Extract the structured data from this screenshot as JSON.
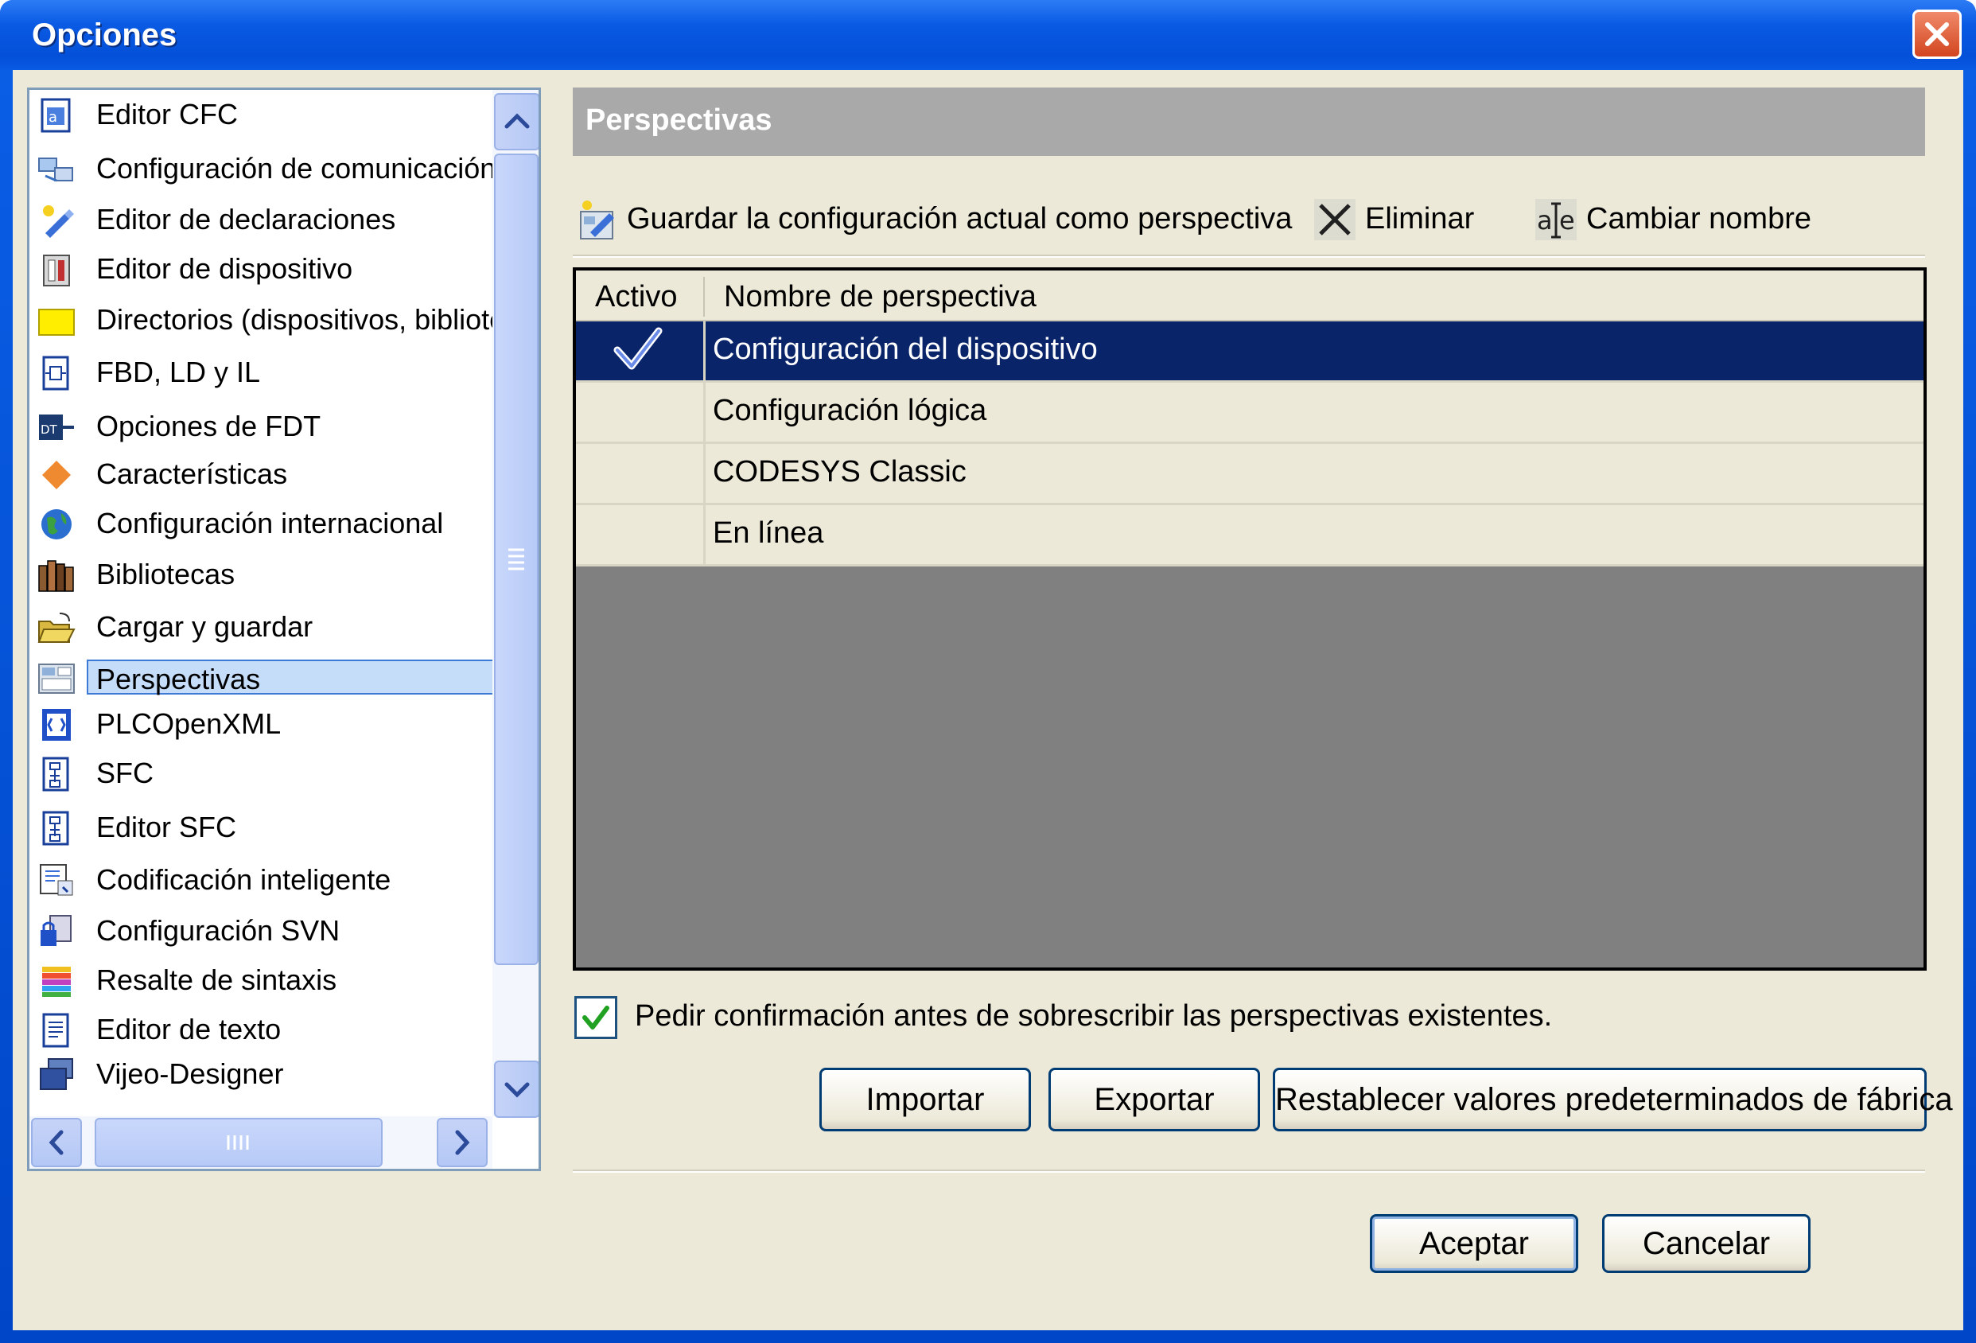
{
  "window": {
    "title": "Opciones"
  },
  "tree": {
    "items": [
      {
        "label": "Editor CFC",
        "icon": "cfc-editor-icon"
      },
      {
        "label": "Configuración de comunicación",
        "icon": "communication-icon"
      },
      {
        "label": "Editor de declaraciones",
        "icon": "declarations-icon"
      },
      {
        "label": "Editor de dispositivo",
        "icon": "device-icon"
      },
      {
        "label": "Directorios (dispositivos, bibliotecas",
        "icon": "folder-icon"
      },
      {
        "label": "FBD, LD y IL",
        "icon": "fbd-icon"
      },
      {
        "label": "Opciones de FDT",
        "icon": "fdt-icon"
      },
      {
        "label": "Características",
        "icon": "diamond-icon"
      },
      {
        "label": "Configuración internacional",
        "icon": "globe-icon"
      },
      {
        "label": "Bibliotecas",
        "icon": "libraries-icon"
      },
      {
        "label": "Cargar y guardar",
        "icon": "open-folder-icon"
      },
      {
        "label": "Perspectivas",
        "icon": "perspectives-icon"
      },
      {
        "label": "PLCOpenXML",
        "icon": "plcopenxml-icon"
      },
      {
        "label": "SFC",
        "icon": "sfc-icon"
      },
      {
        "label": "Editor SFC",
        "icon": "sfc-editor-icon"
      },
      {
        "label": "Codificación inteligente",
        "icon": "smart-coding-icon"
      },
      {
        "label": "Configuración SVN",
        "icon": "svn-icon"
      },
      {
        "label": "Resalte de sintaxis",
        "icon": "syntax-highlight-icon"
      },
      {
        "label": "Editor de texto",
        "icon": "text-editor-icon"
      },
      {
        "label": "Vijeo-Designer",
        "icon": "vijeo-icon"
      }
    ],
    "selected": "Perspectivas"
  },
  "panel": {
    "title": "Perspectivas",
    "toolbar": {
      "save": "Guardar la configuración actual como perspectiva",
      "delete": "Eliminar",
      "rename": "Cambiar nombre"
    },
    "table": {
      "columns": [
        "Activo",
        "Nombre de perspectiva"
      ],
      "rows": [
        {
          "active": true,
          "name": "Configuración del dispositivo"
        },
        {
          "active": false,
          "name": "Configuración lógica"
        },
        {
          "active": false,
          "name": "CODESYS Classic"
        },
        {
          "active": false,
          "name": "En línea"
        }
      ]
    },
    "confirm_checkbox": {
      "label": "Pedir confirmación antes de sobrescribir las perspectivas existentes.",
      "checked": true
    },
    "buttons": {
      "import": "Importar",
      "export": "Exportar",
      "reset": "Restablecer valores predeterminados de fábrica"
    }
  },
  "footer": {
    "ok": "Aceptar",
    "cancel": "Cancelar"
  },
  "colors": {
    "titlebar": "#0a5ae4",
    "selection": "#0a246a",
    "tree_selection": "#c6ddfa",
    "dialog_bg": "#ece9d8"
  }
}
